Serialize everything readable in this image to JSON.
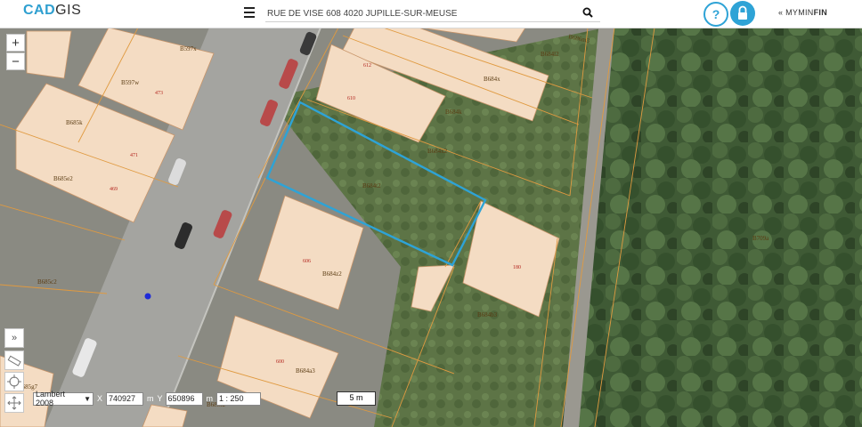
{
  "header": {
    "logo_part1": "CAD",
    "logo_part2": "GIS",
    "address": "RUE DE VISÉ 608 4020 JUPILLE-SUR-MEUSE",
    "account_prefix": "« MYMIN",
    "account_bold": "FIN"
  },
  "map_controls": {
    "zoom_in": "+",
    "zoom_out": "−",
    "expand": "»"
  },
  "coords": {
    "projection": "Lambert 2008",
    "x_label": "X",
    "x_value": "740927",
    "x_unit": "m",
    "y_label": "Y",
    "y_value": "650896",
    "y_unit": "m",
    "scale": "1 : 250",
    "scalebar": "5 m"
  },
  "parcels": [
    {
      "id": "p1",
      "label": "B597x"
    },
    {
      "id": "p2",
      "label": "B597w",
      "num": "473"
    },
    {
      "id": "p3",
      "label": "B685k",
      "num": "471"
    },
    {
      "id": "p4",
      "label": "B685e2",
      "num": "469"
    },
    {
      "id": "p5",
      "label": "B685c2"
    },
    {
      "id": "p6",
      "label": "B684x",
      "num": "612"
    },
    {
      "id": "p7",
      "label": "B684k",
      "num": "610"
    },
    {
      "id": "p8",
      "label": "B684x2"
    },
    {
      "id": "p9",
      "label": "B684t2"
    },
    {
      "id": "p10",
      "label": "B684z2",
      "num": "606"
    },
    {
      "id": "p11",
      "label": "B684b3",
      "num": "180"
    },
    {
      "id": "p12",
      "label": "B684a3",
      "num": "600"
    },
    {
      "id": "p13",
      "label": "B684l2"
    },
    {
      "id": "p14",
      "label": "B686m3"
    },
    {
      "id": "p15",
      "label": "B709a"
    },
    {
      "id": "p16",
      "label": "B685f2"
    },
    {
      "id": "p17",
      "label": "B685g7"
    }
  ],
  "colors": {
    "accent": "#2ea3d6",
    "building": "#f4dcc3",
    "parcel_line": "#e09a40",
    "selection": "#2ea3d6"
  }
}
